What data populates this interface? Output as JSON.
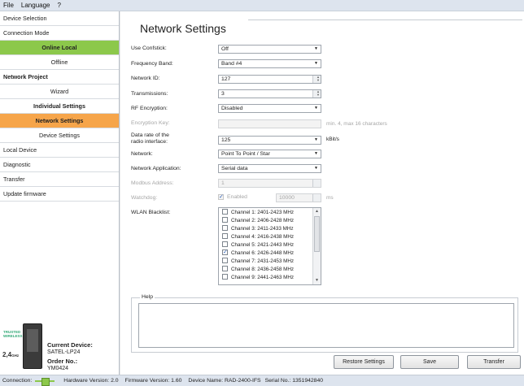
{
  "menu": {
    "file": "File",
    "language": "Language",
    "help": "?"
  },
  "sidebar": {
    "items": [
      {
        "label": "Device Selection"
      },
      {
        "label": "Connection Mode"
      },
      {
        "label": "Online Local"
      },
      {
        "label": "Offline"
      },
      {
        "label": "Network Project"
      },
      {
        "label": "Wizard"
      },
      {
        "label": "Individual Settings"
      },
      {
        "label": "Network Settings"
      },
      {
        "label": "Device Settings"
      },
      {
        "label": "Local Device"
      },
      {
        "label": "Diagnostic"
      },
      {
        "label": "Transfer"
      },
      {
        "label": "Update firmware"
      }
    ],
    "device": {
      "brand_top": "TRUSTED",
      "brand_bottom": "WIRELESS",
      "band": "2,4",
      "band_unit": "GHz",
      "current_label": "Current Device:",
      "current_value": "SATEL-LP24",
      "order_label": "Order No.:",
      "order_value": "YM0424"
    }
  },
  "page": {
    "title": "Network Settings"
  },
  "form": {
    "use_confstick": {
      "label": "Use Confstick:",
      "value": "Off"
    },
    "frequency_band": {
      "label": "Frequency Band:",
      "value": "Band #4"
    },
    "network_id": {
      "label": "Network ID:",
      "value": "127"
    },
    "transmissions": {
      "label": "Transmissions:",
      "value": "3"
    },
    "rf_encryption": {
      "label": "RF Encryption:",
      "value": "Disabled"
    },
    "encryption_key": {
      "label": "Encryption Key:",
      "value": "",
      "hint": "min. 4, max 16 characters"
    },
    "data_rate": {
      "label_line1": "Data rate of the",
      "label_line2": "radio interface:",
      "value": "125",
      "unit": "kBit/s"
    },
    "network": {
      "label": "Network:",
      "value": "Point To Point / Star"
    },
    "network_application": {
      "label": "Network Application:",
      "value": "Serial data"
    },
    "modbus_address": {
      "label": "Modbus Address:",
      "value": "1"
    },
    "watchdog": {
      "label": "Watchdog:",
      "enabled_label": "Enabled",
      "checked": true,
      "value": "10000",
      "unit": "ms"
    },
    "wlan_blacklist": {
      "label": "WLAN Blacklist:",
      "channels": [
        {
          "label": "Channel 1: 2401-2423 MHz",
          "checked": false
        },
        {
          "label": "Channel 2: 2406-2428 MHz",
          "checked": false
        },
        {
          "label": "Channel 3: 2411-2433 MHz",
          "checked": false
        },
        {
          "label": "Channel 4: 2416-2438 MHz",
          "checked": false
        },
        {
          "label": "Channel 5: 2421-2443 MHz",
          "checked": false
        },
        {
          "label": "Channel 6: 2426-2448 MHz",
          "checked": true
        },
        {
          "label": "Channel 7: 2431-2453 MHz",
          "checked": false
        },
        {
          "label": "Channel 8: 2436-2458 MHz",
          "checked": false
        },
        {
          "label": "Channel 9: 2441-2463 MHz",
          "checked": false
        }
      ]
    }
  },
  "help": {
    "label": "Help",
    "text": ""
  },
  "buttons": {
    "restore": "Restore Settings",
    "save": "Save",
    "transfer": "Transfer"
  },
  "status": {
    "connection_label": "Connection:",
    "hardware_version": "Hardware Version:  2.0",
    "firmware_version": "Firmware Version:  1.60",
    "device_name": "Device Name:  RAD-2400-IFS",
    "serial_no": "Serial No.:  1351942840"
  },
  "colors": {
    "active_green": "#8cc84b",
    "active_orange": "#f6a54a",
    "accent_blue": "#2b5fb7"
  }
}
